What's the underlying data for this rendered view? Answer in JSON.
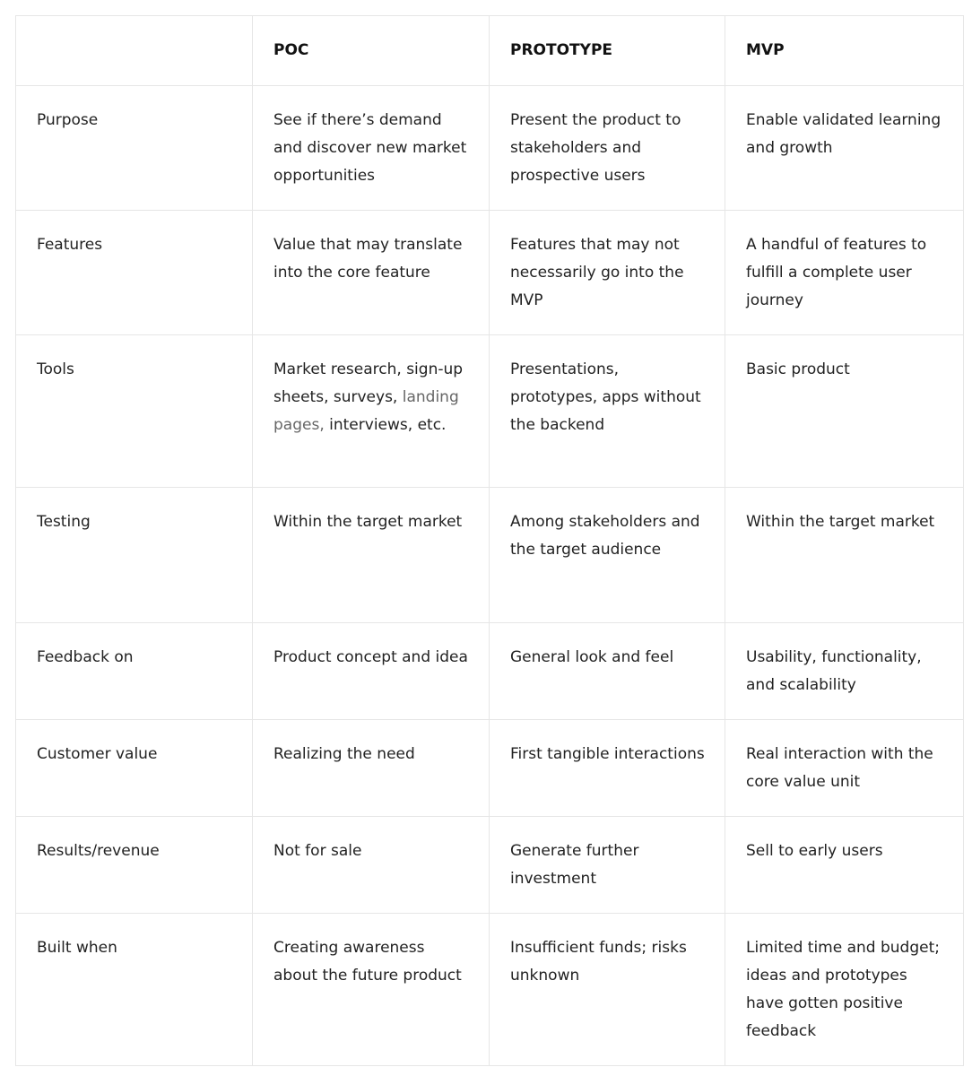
{
  "table": {
    "headers": [
      "",
      "POC",
      "PROTOTYPE",
      "MVP"
    ],
    "rows": [
      {
        "label": "Purpose",
        "poc": "See if there’s demand and discover new market opportunities",
        "prototype": "Present the product to stakeholders and prospective users",
        "mvp": "Enable validated learning and growth"
      },
      {
        "label": "Features",
        "poc": "Value that may translate into the core feature",
        "prototype": "Features that may not necessarily go into the MVP",
        "mvp": "A handful of features to fulfill a complete user journey"
      },
      {
        "label": "Tools",
        "poc": "Market research, sign-up sheets, surveys,",
        "poc_link": "landing pages,",
        "poc_tail": "interviews, etc.",
        "prototype": "Presentations, prototypes, apps without the backend",
        "mvp": "Basic product"
      },
      {
        "label": "Testing",
        "poc": "Within the target market",
        "prototype": "Among stakeholders and the target audience",
        "mvp": "Within the target market"
      },
      {
        "label": "Feedback on",
        "poc": "Product concept and idea",
        "prototype": "General look and feel",
        "mvp": "Usability, functionality, and scalability"
      },
      {
        "label": "Customer value",
        "poc": "Realizing the need",
        "prototype": "First tangible interactions",
        "mvp": "Real interaction with the core value unit"
      },
      {
        "label": "Results/revenue",
        "poc": "Not for sale",
        "prototype": "Generate further investment",
        "mvp": "Sell to early users"
      },
      {
        "label": "Built when",
        "poc": "Creating awareness about the future product",
        "prototype": "Insufficient funds; risks unknown",
        "mvp": "Limited time and budget; ideas and prototypes have gotten positive feedback"
      }
    ]
  }
}
